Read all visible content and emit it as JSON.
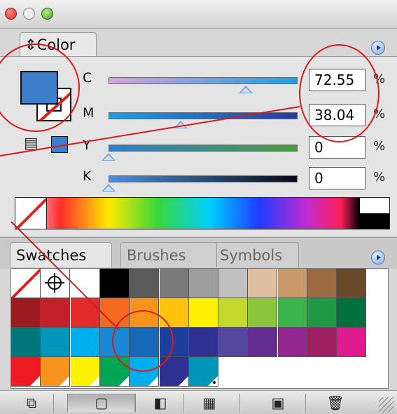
{
  "color_panel": {
    "tab_label": "Color",
    "channels": [
      {
        "label": "C",
        "value": "72.55",
        "unit": "%",
        "fraction": 0.7255,
        "gradient": "#d8a4d8,#1ea0e0"
      },
      {
        "label": "M",
        "value": "38.04",
        "unit": "%",
        "fraction": 0.3804,
        "gradient": "#1ea0e0,#2a3aa0"
      },
      {
        "label": "Y",
        "value": "0",
        "unit": "%",
        "fraction": 0.0,
        "gradient": "#2e7fcf,#4a9a3a"
      },
      {
        "label": "K",
        "value": "0",
        "unit": "%",
        "fraction": 0.0,
        "gradient": "#4a8ee0,#050a14"
      }
    ],
    "fill_color": "#3d7ecb"
  },
  "swatch_panel": {
    "tabs": [
      "Swatches",
      "Brushes",
      "Symbols"
    ],
    "rows": [
      [
        "none",
        "registration",
        "#ffffff",
        "#000000",
        "#5a5a5a",
        "#7a7a7a",
        "#9e9e9e",
        "#c0c0c0",
        "#e0bfa0",
        "#c89a6a",
        "#9a6a40",
        "#6a4a2a"
      ],
      [
        "#9b1b20",
        "#c3202a",
        "#e52a2a",
        "#f36a1f",
        "#f7941d",
        "#ffc20e",
        "#fff200",
        "#c4d82e",
        "#8cc63f",
        "#39b54a",
        "#1e9a45",
        "#00703c"
      ],
      [
        "#00767a",
        "#0096b7",
        "#00aeef",
        "#1c87d4",
        "#1668b8",
        "#1b3f9a",
        "#2e3192",
        "#55479e",
        "#662d91",
        "#92278f",
        "#9e1f63",
        "#e0198e"
      ],
      [
        "#ed1c24",
        "#f7941d",
        "#fff200",
        "#00a651",
        "#00aeef",
        "#2e3192",
        "#0096b7"
      ]
    ]
  },
  "bottom_toolbar": {
    "icons": [
      "swatch-libraries-icon",
      "show-color-swatches-icon",
      "show-gradient-swatches-icon",
      "show-pattern-swatches-icon",
      "new-swatch-icon",
      "delete-swatch-icon"
    ]
  }
}
